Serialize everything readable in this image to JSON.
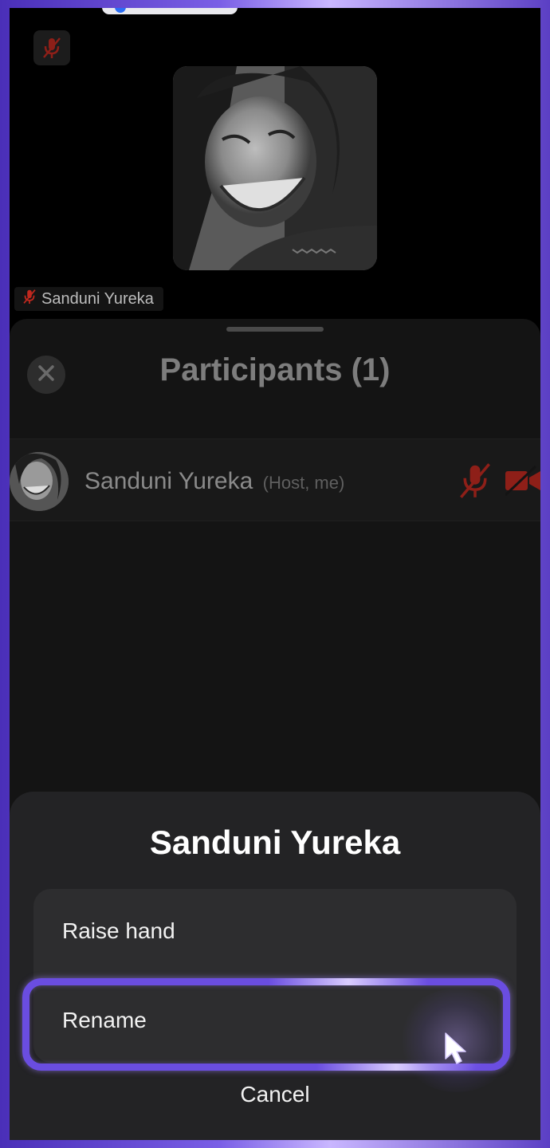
{
  "video": {
    "participant_name": "Sanduni Yureka"
  },
  "participants_panel": {
    "title": "Participants (1)",
    "participants": [
      {
        "name": "Sanduni Yureka",
        "role": "(Host, me)"
      }
    ]
  },
  "action_sheet": {
    "title": "Sanduni Yureka",
    "options": [
      "Raise hand",
      "Rename"
    ],
    "cancel_label": "Cancel"
  },
  "icons": {
    "mute": "mic-off-icon",
    "camera_off": "camera-off-icon",
    "close": "close-icon",
    "cursor": "cursor-pointer-icon"
  },
  "colors": {
    "muted_red": "#c0281e",
    "highlight": "#6a4de0",
    "sheet_bg": "#232325"
  }
}
